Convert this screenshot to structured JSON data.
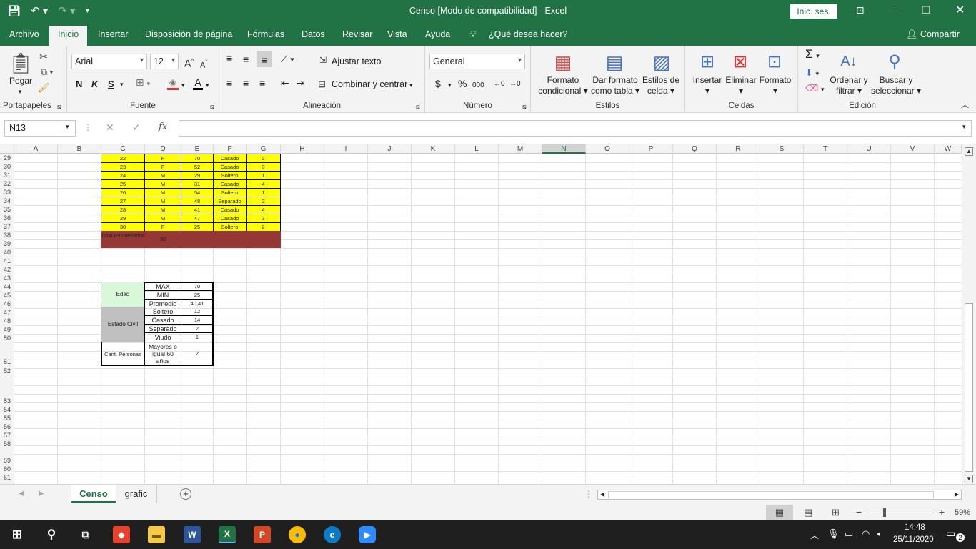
{
  "window": {
    "title": "Censo  [Modo de compatibilidad]  -  Excel",
    "signin": "Inic. ses."
  },
  "tabs": [
    "Archivo",
    "Inicio",
    "Insertar",
    "Disposición de página",
    "Fórmulas",
    "Datos",
    "Revisar",
    "Vista",
    "Ayuda"
  ],
  "tell_me": "¿Qué desea hacer?",
  "share": "Compartir",
  "ribbon": {
    "clipboard": {
      "paste": "Pegar",
      "label": "Portapapeles"
    },
    "font": {
      "name": "Arial",
      "size": "12",
      "label": "Fuente",
      "bold": "N",
      "italic": "K",
      "underline": "S"
    },
    "alignment": {
      "wrap": "Ajustar texto",
      "merge": "Combinar y centrar",
      "label": "Alineación"
    },
    "number": {
      "format": "General",
      "label": "Número",
      "currency": "$",
      "percent": "%",
      "thousands": "000"
    },
    "styles": {
      "conditional": [
        "Formato",
        "condicional"
      ],
      "table": [
        "Dar formato",
        "como tabla"
      ],
      "cell": [
        "Estilos de",
        "celda"
      ],
      "label": "Estilos"
    },
    "cells": {
      "insert": "Insertar",
      "delete": "Eliminar",
      "format": "Formato",
      "label": "Celdas"
    },
    "editing": {
      "sort": [
        "Ordenar y",
        "filtrar"
      ],
      "find": [
        "Buscar y",
        "seleccionar"
      ],
      "label": "Edición"
    }
  },
  "formula_bar": {
    "name_box": "N13",
    "formula": "",
    "fx": "fx"
  },
  "columns": [
    "A",
    "B",
    "C",
    "D",
    "E",
    "F",
    "G",
    "H",
    "I",
    "J",
    "K",
    "L",
    "M",
    "N",
    "O",
    "P",
    "Q",
    "R",
    "S",
    "T",
    "U",
    "V",
    "W"
  ],
  "rows": [
    "29",
    "30",
    "31",
    "32",
    "33",
    "34",
    "35",
    "36",
    "37",
    "38",
    "39",
    "40",
    "41",
    "42",
    "43",
    "44",
    "45",
    "46",
    "47",
    "48",
    "49",
    "50",
    "51",
    "52",
    "53",
    "54",
    "55",
    "56",
    "57",
    "58",
    "59",
    "60",
    "61"
  ],
  "data_rows": [
    [
      "22",
      "F",
      "70",
      "Casado",
      "2"
    ],
    [
      "23",
      "F",
      "52",
      "Casado",
      "3"
    ],
    [
      "24",
      "M",
      "29",
      "Soltero",
      "1"
    ],
    [
      "25",
      "M",
      "31",
      "Casado",
      "4"
    ],
    [
      "26",
      "M",
      "54",
      "Soltero",
      "1"
    ],
    [
      "27",
      "M",
      "48",
      "Separado",
      "2"
    ],
    [
      "28",
      "M",
      "41",
      "Casado",
      "4"
    ],
    [
      "29",
      "M",
      "47",
      "Casado",
      "3"
    ],
    [
      "30",
      "F",
      "25",
      "Soltero",
      "2"
    ]
  ],
  "total": {
    "label": "Total Encuestados",
    "value": "30"
  },
  "summary": {
    "edad": {
      "label": "Edad",
      "rows": [
        [
          "MAX",
          "70"
        ],
        [
          "MIN",
          "25"
        ],
        [
          "Promedio",
          "40,41"
        ]
      ]
    },
    "estado": {
      "label": "Estado Civil",
      "rows": [
        [
          "Soltero",
          "12"
        ],
        [
          "Casado",
          "14"
        ],
        [
          "Separado",
          "2"
        ],
        [
          "Viudo",
          "1"
        ]
      ]
    },
    "personas": {
      "label": "Cant. Personas",
      "desc": "Mayores o igual 60 años",
      "value": "2"
    }
  },
  "sheets": [
    "Censo",
    "grafic"
  ],
  "status": {
    "zoom": "59%"
  },
  "taskbar": {
    "time": "14:48",
    "date": "25/11/2020",
    "notifications": "2"
  }
}
